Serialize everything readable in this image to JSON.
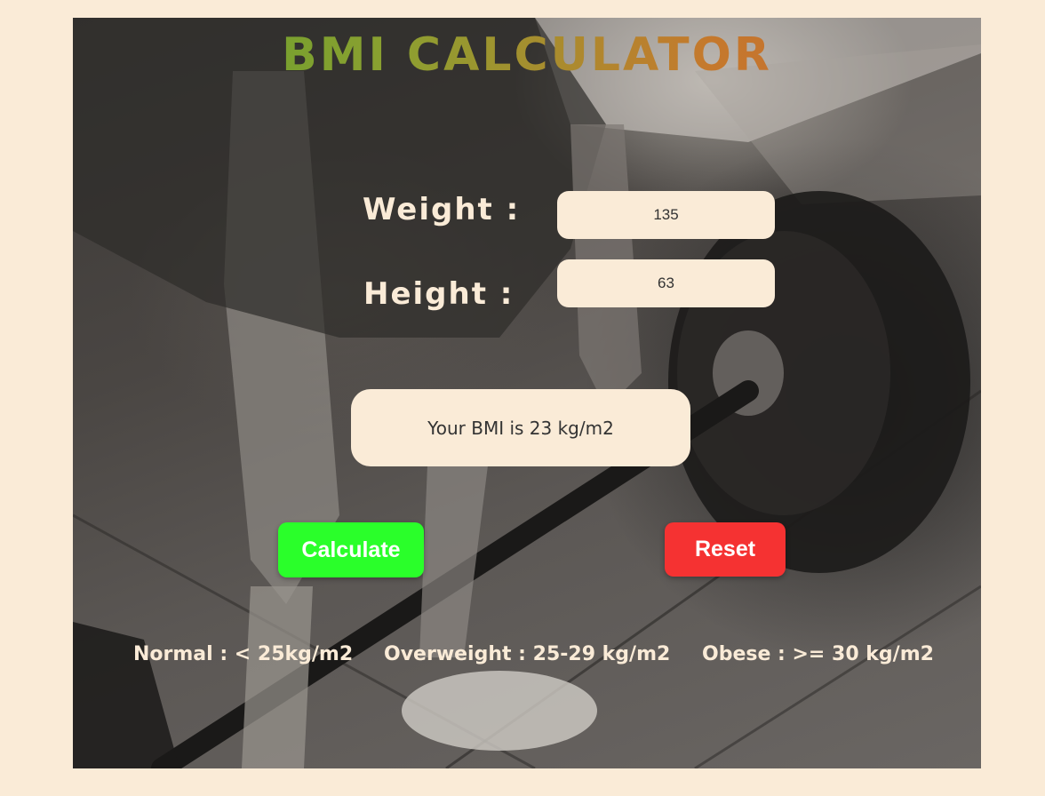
{
  "title": "BMI CALCULATOR",
  "form": {
    "weight_label": "Weight :",
    "weight_value": "135",
    "height_label": "Height :",
    "height_value": "63"
  },
  "result": {
    "text": "Your BMI is 23 kg/m2"
  },
  "buttons": {
    "calculate_label": "Calculate",
    "reset_label": "Reset"
  },
  "ranges": [
    {
      "text": "Normal : < 25kg/m2"
    },
    {
      "text": "Overweight : 25-29 kg/m2"
    },
    {
      "text": "Obese : >= 30 kg/m2"
    }
  ],
  "colors": {
    "page_background": "#faebd7",
    "field_background": "#faebd7",
    "calculate_button": "#2aff2a",
    "reset_button": "#f53232",
    "title_gradient_start": "#58a12c",
    "title_gradient_end": "#c46630"
  },
  "background_image": "black-and-white gym photo: person gripping loaded barbell for deadlift"
}
